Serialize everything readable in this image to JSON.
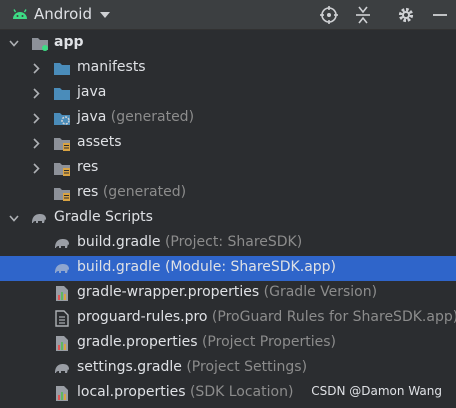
{
  "toolbar": {
    "view_label": "Android",
    "icons": [
      "android-icon",
      "chevron-down-icon",
      "crosshair-icon",
      "collapse-all-icon",
      "gear-icon",
      "minimize-icon"
    ]
  },
  "tree": {
    "app": "app",
    "manifests": "manifests",
    "java": "java",
    "java_generated": "java",
    "java_generated_hint": "(generated)",
    "assets": "assets",
    "res": "res",
    "res_generated": "res",
    "res_generated_hint": "(generated)",
    "gradle_scripts": "Gradle Scripts",
    "files": [
      {
        "name": "build.gradle",
        "hint": "(Project: ShareSDK)",
        "icon": "gradle-icon"
      },
      {
        "name": "build.gradle",
        "hint": "(Module: ShareSDK.app)",
        "icon": "gradle-icon"
      },
      {
        "name": "gradle-wrapper.properties",
        "hint": "(Gradle Version)",
        "icon": "properties-icon"
      },
      {
        "name": "proguard-rules.pro",
        "hint": "(ProGuard Rules for ShareSDK.app)",
        "icon": "text-file-icon"
      },
      {
        "name": "gradle.properties",
        "hint": "(Project Properties)",
        "icon": "properties-icon"
      },
      {
        "name": "settings.gradle",
        "hint": "(Project Settings)",
        "icon": "gradle-icon"
      },
      {
        "name": "local.properties",
        "hint": "(SDK Location)",
        "icon": "properties-icon"
      }
    ]
  },
  "colors": {
    "background": "#2b2d30",
    "selection": "#2f65ca",
    "android_green": "#3ddc84",
    "folder_blue": "#4a8cba",
    "hint_gray": "#8c8c8c"
  },
  "watermark": "CSDN @Damon Wang"
}
